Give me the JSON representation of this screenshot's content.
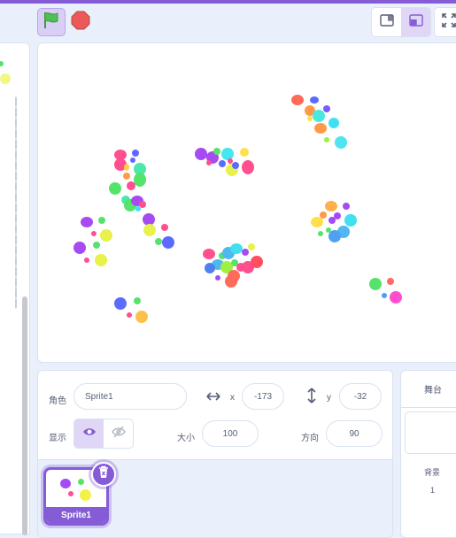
{
  "toolbar": {
    "green_flag_icon": "green-flag-icon",
    "stop_icon": "stop-sign-icon",
    "small_stage_icon": "small-stage-icon",
    "normal_stage_icon": "normal-stage-icon",
    "fullscreen_icon": "fullscreen-icon",
    "colors": {
      "accent": "#855cd6",
      "flag": "#4cbf56",
      "stop": "#ec5959"
    }
  },
  "sprite_info": {
    "sprite_label": "角色",
    "sprite_name": "Sprite1",
    "x_label": "x",
    "x_value": "-173",
    "y_label": "y",
    "y_value": "-32",
    "show_label": "显示",
    "size_label": "大小",
    "size_value": "100",
    "direction_label": "方向",
    "direction_value": "90"
  },
  "sprite_list": {
    "items": [
      {
        "name": "Sprite1",
        "selected": true
      }
    ]
  },
  "stage_panel": {
    "title": "舞台",
    "backdrops_label": "背景",
    "backdrops_count": "1"
  }
}
